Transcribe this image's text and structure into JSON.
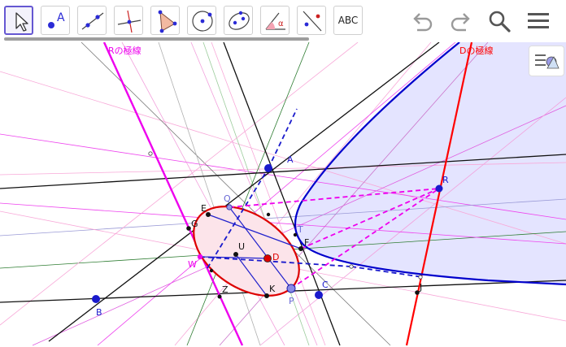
{
  "toolbar": {
    "tools": [
      {
        "id": "move",
        "icon": "move-arrow-icon"
      },
      {
        "id": "point",
        "icon": "point-icon",
        "label": "A"
      },
      {
        "id": "line",
        "icon": "line-through-points-icon"
      },
      {
        "id": "perpendicular",
        "icon": "perpendicular-line-icon"
      },
      {
        "id": "polygon",
        "icon": "polygon-icon"
      },
      {
        "id": "circle",
        "icon": "circle-center-icon"
      },
      {
        "id": "ellipse",
        "icon": "ellipse-icon"
      },
      {
        "id": "angle",
        "icon": "angle-icon",
        "label": "α"
      },
      {
        "id": "reflect",
        "icon": "reflect-icon"
      },
      {
        "id": "text",
        "icon": "text-icon",
        "label": "ABC"
      }
    ],
    "undo_icon": "undo-icon",
    "redo_icon": "redo-icon",
    "search_icon": "search-icon",
    "menu_icon": "menu-icon"
  },
  "style_bar_icon": "style-bar-toggle-icon",
  "canvas": {
    "headings": {
      "polar_R": "Rの極線",
      "polar_D": "Dの極線"
    },
    "points": {
      "A": "A",
      "B": "B",
      "C": "C",
      "D": "D",
      "E": "E",
      "F": "F",
      "G": "G",
      "J": "J",
      "K": "K",
      "P": "P",
      "Q": "Q",
      "R": "R",
      "T": "T",
      "U": "U",
      "W": "W",
      "Z": "Z"
    }
  },
  "colors": {
    "accent": "#6557d2",
    "parabola": "#0000cc",
    "ellipse": "#dd0000",
    "magenta": "#ee00ee",
    "polar_red": "#ff0000",
    "shade_blue": "#e4e4ff",
    "shade_pink": "#fce4ea"
  }
}
